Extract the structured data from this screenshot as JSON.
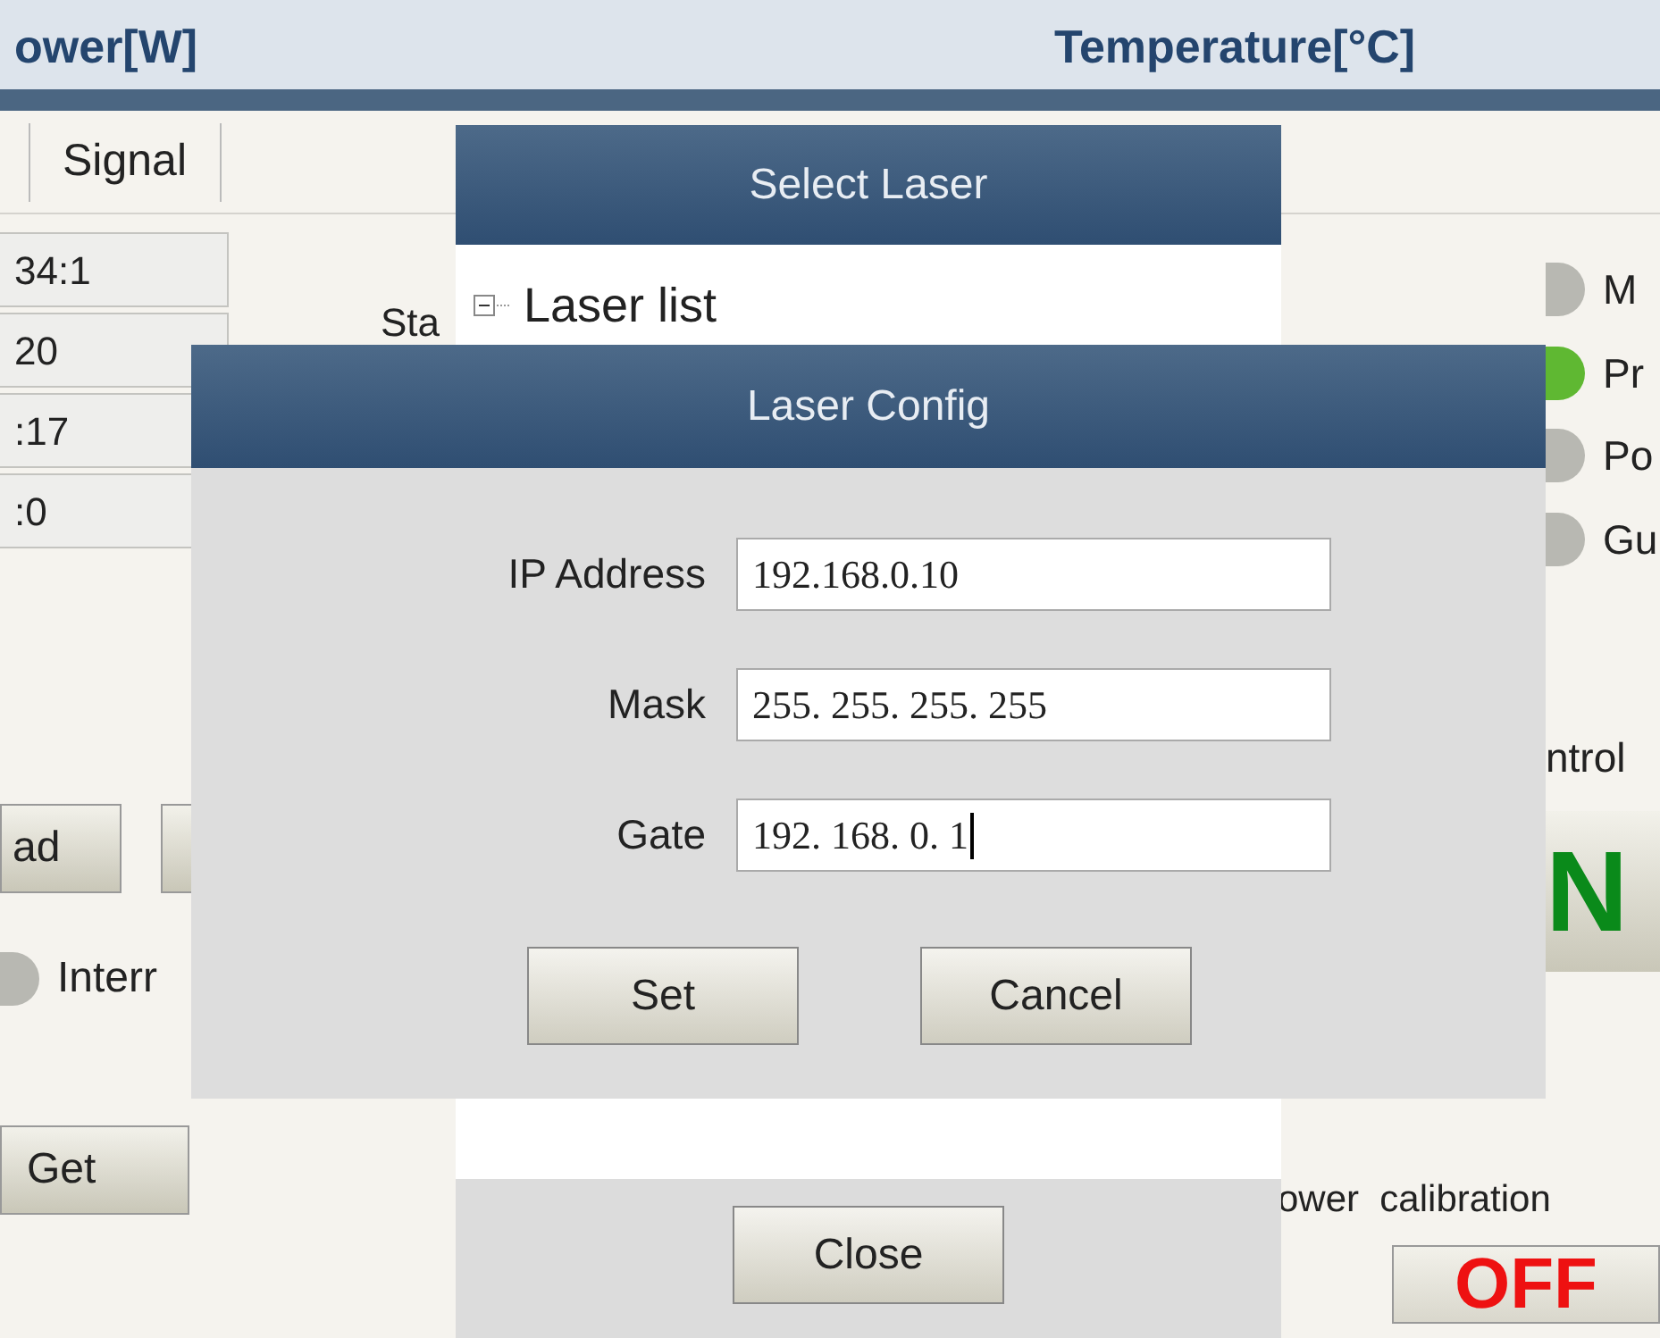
{
  "header": {
    "columns": [
      "ower[W]",
      "Temperature[°C]"
    ]
  },
  "tabs": [
    {
      "label": "Signal"
    }
  ],
  "left_panel": {
    "fields": [
      "34:1",
      "20",
      ":17",
      ":0"
    ],
    "buttons": [
      "ad"
    ],
    "indicators": [
      {
        "label": "Interr",
        "on": false
      }
    ],
    "get_button": "Get"
  },
  "status_group": {
    "label": "Sta"
  },
  "right_panel": {
    "indicators": [
      {
        "label": "M",
        "on": false
      },
      {
        "label": "Pr",
        "on": true
      },
      {
        "label": "Po",
        "on": false
      },
      {
        "label": "Gu",
        "on": false
      }
    ],
    "control_label": "ntrol",
    "on_button": "N",
    "calibration_label": "ower  calibration",
    "off_button": "OFF"
  },
  "select_laser_dialog": {
    "title": "Select Laser",
    "tree": [
      {
        "label": "Laser list",
        "expanded": true
      }
    ],
    "close_button": "Close"
  },
  "laser_config_dialog": {
    "title": "Laser Config",
    "fields": [
      {
        "label": "IP Address",
        "value": "192.168.0.10",
        "focused": false
      },
      {
        "label": "Mask",
        "value": "255. 255. 255. 255",
        "focused": false
      },
      {
        "label": "Gate",
        "value": "192. 168. 0. 1",
        "focused": true
      }
    ],
    "buttons": [
      "Set",
      "Cancel"
    ]
  }
}
